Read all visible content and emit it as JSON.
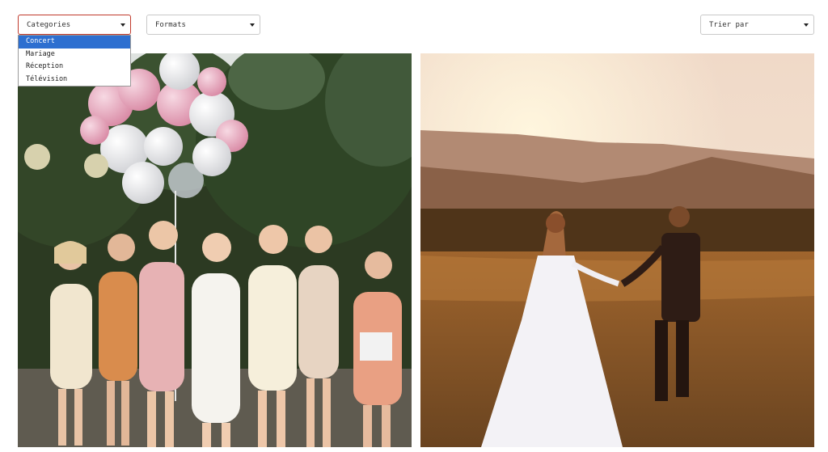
{
  "filters": {
    "categories": {
      "label": "Categories",
      "options": [
        "Concert",
        "Mariage",
        "Réception",
        "Télévision"
      ],
      "selected_index": 0
    },
    "formats": {
      "label": "Formats"
    },
    "sort": {
      "label": "Trier par"
    }
  },
  "gallery": {
    "photos": [
      {
        "subject": "group of women with balloons"
      },
      {
        "subject": "wedding couple in field at sunset"
      }
    ]
  }
}
